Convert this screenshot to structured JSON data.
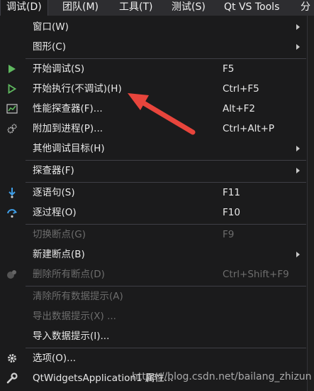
{
  "menubar": {
    "items": [
      {
        "label": "调试(D)"
      },
      {
        "label": "团队(M)"
      },
      {
        "label": "工具(T)"
      },
      {
        "label": "测试(S)"
      },
      {
        "label": "Qt VS Tools"
      },
      {
        "label": "分"
      }
    ]
  },
  "menu": {
    "items": [
      {
        "label": "窗口(W)",
        "shortcut": "",
        "icon": "",
        "submenu": true,
        "enabled": true
      },
      {
        "label": "图形(C)",
        "shortcut": "",
        "icon": "",
        "submenu": true,
        "enabled": true
      },
      {
        "label": "开始调试(S)",
        "shortcut": "F5",
        "icon": "play-filled-icon",
        "submenu": false,
        "enabled": true
      },
      {
        "label": "开始执行(不调试)(H)",
        "shortcut": "Ctrl+F5",
        "icon": "play-outline-icon",
        "submenu": false,
        "enabled": true
      },
      {
        "label": "性能探查器(F)...",
        "shortcut": "Alt+F2",
        "icon": "performance-icon",
        "submenu": false,
        "enabled": true
      },
      {
        "label": "附加到进程(P)...",
        "shortcut": "Ctrl+Alt+P",
        "icon": "attach-gears-icon",
        "submenu": false,
        "enabled": true
      },
      {
        "label": "其他调试目标(H)",
        "shortcut": "",
        "icon": "",
        "submenu": true,
        "enabled": true
      },
      {
        "label": "探查器(F)",
        "shortcut": "",
        "icon": "",
        "submenu": true,
        "enabled": true
      },
      {
        "label": "逐语句(S)",
        "shortcut": "F11",
        "icon": "step-into-icon",
        "submenu": false,
        "enabled": true
      },
      {
        "label": "逐过程(O)",
        "shortcut": "F10",
        "icon": "step-over-icon",
        "submenu": false,
        "enabled": true
      },
      {
        "label": "切换断点(G)",
        "shortcut": "F9",
        "icon": "",
        "submenu": false,
        "enabled": false
      },
      {
        "label": "新建断点(B)",
        "shortcut": "",
        "icon": "",
        "submenu": true,
        "enabled": true
      },
      {
        "label": "删除所有断点(D)",
        "shortcut": "Ctrl+Shift+F9",
        "icon": "delete-breakpoints-icon",
        "submenu": false,
        "enabled": false
      },
      {
        "label": "清除所有数据提示(A)",
        "shortcut": "",
        "icon": "",
        "submenu": false,
        "enabled": false
      },
      {
        "label": "导出数据提示(X) ...",
        "shortcut": "",
        "icon": "",
        "submenu": false,
        "enabled": false
      },
      {
        "label": "导入数据提示(I)...",
        "shortcut": "",
        "icon": "",
        "submenu": false,
        "enabled": true
      },
      {
        "label": "选项(O)...",
        "shortcut": "",
        "icon": "gear-icon",
        "submenu": false,
        "enabled": true
      },
      {
        "label": "QtWidgetsApplication1 属性...",
        "shortcut": "",
        "icon": "wrench-icon",
        "submenu": false,
        "enabled": true
      }
    ]
  },
  "watermark": "https://blog.csdn.net/bailang_zhizun",
  "colors": {
    "accent_green": "#5fb85f",
    "accent_blue": "#3f9fe8",
    "callout_red": "#e8453c"
  }
}
